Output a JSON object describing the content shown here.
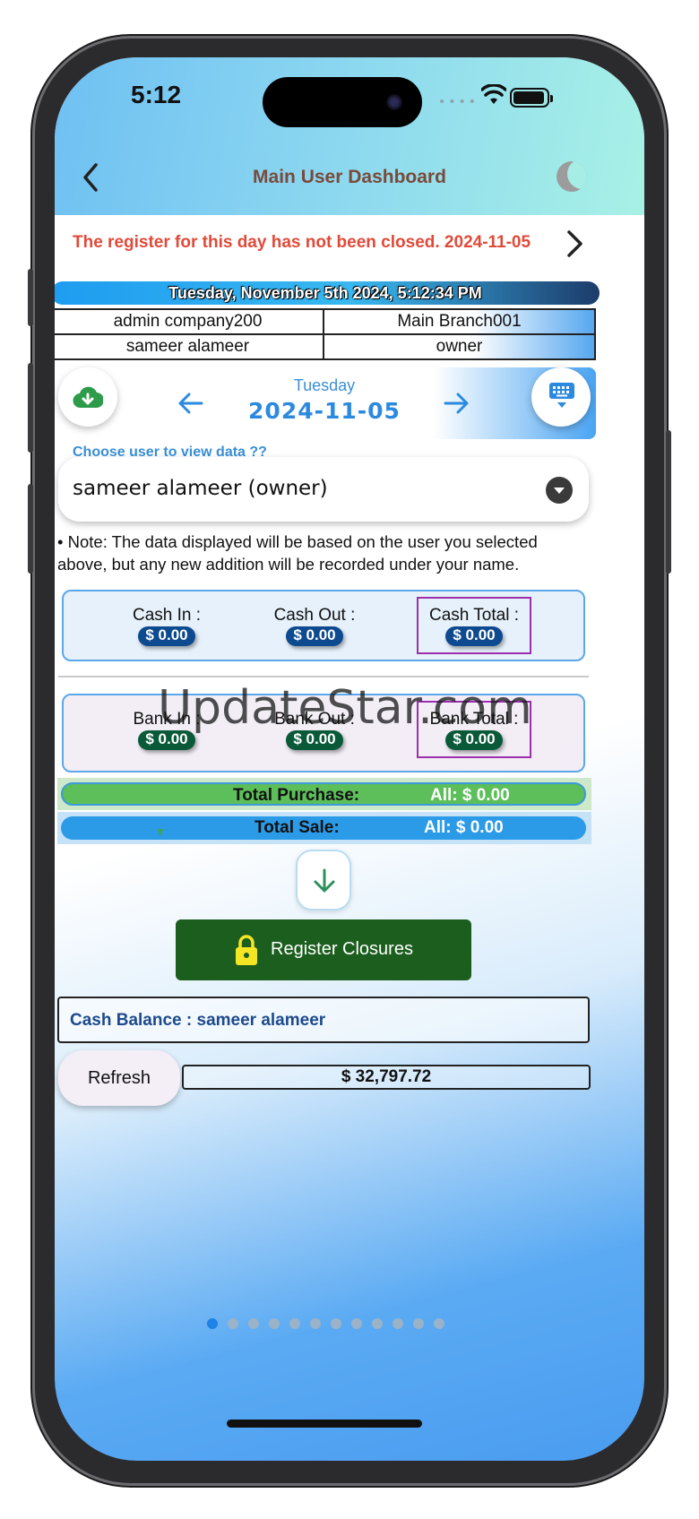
{
  "status_bar": {
    "time": "5:12"
  },
  "nav": {
    "title": "Main User Dashboard"
  },
  "alert": {
    "message": "The register for this day has not been closed. 2024-11-05"
  },
  "datetime_banner": "Tuesday, November 5th 2024, 5:12:34 PM",
  "info": {
    "company": "admin company200",
    "branch": "Main Branch001",
    "user_name": "sameer alameer",
    "role": "owner"
  },
  "date_picker": {
    "day": "Tuesday",
    "date": "2024-11-05"
  },
  "user_select": {
    "label": "Choose user to view data ??",
    "selected": "sameer alameer (owner)"
  },
  "note": "• Note: The data displayed will be based on the user you selected above, but any new addition will be recorded under your name.",
  "cash": {
    "in_label": "Cash In    :",
    "in_value": "$ 0.00",
    "out_label": "Cash Out  :",
    "out_value": "$ 0.00",
    "total_label": "Cash Total :",
    "total_value": "$ 0.00"
  },
  "bank": {
    "in_label": "Bank In    :",
    "in_value": "$ 0.00",
    "out_label": "Bank Out  :",
    "out_value": "$ 0.00",
    "total_label": "Bank Total :",
    "total_value": "$ 0.00"
  },
  "watermark": "UpdateStar.com",
  "totals": {
    "purchase_label": "Total Purchase:",
    "purchase_value": "All:  $ 0.00",
    "sale_label": "Total Sale:",
    "sale_value": "All: $ 0.00"
  },
  "register_button": "Register Closures",
  "balance": {
    "label": "Cash Balance : sameer alameer",
    "refresh": "Refresh",
    "amount": "$ 32,797.72"
  },
  "colors": {
    "accent_blue": "#2b8adf",
    "alert_red": "#e04a3a",
    "register_green": "#1c5e1e",
    "highlight_purple": "#9b2fae"
  },
  "icons": [
    "back-chevron-icon",
    "moon-icon",
    "chevron-right-icon",
    "cloud-download-icon",
    "arrow-left-icon",
    "arrow-right-icon",
    "keyboard-icon",
    "dropdown-icon",
    "arrow-down-icon",
    "lock-icon",
    "wifi-icon",
    "battery-icon"
  ]
}
